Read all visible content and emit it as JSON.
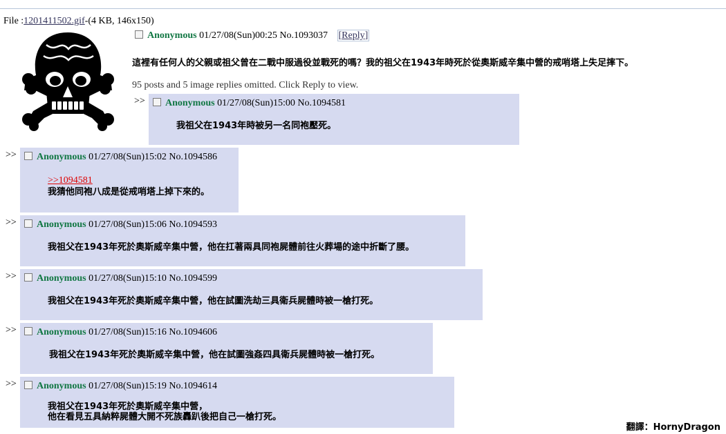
{
  "file": {
    "prefix": "File :",
    "filename": "1201411502.gif",
    "meta": "-(4 KB, 146x150)"
  },
  "op": {
    "name": "Anonymous",
    "datetime": "01/27/08(Sun)00:25",
    "number": "No.1093037",
    "reply_label": "Reply",
    "message": "這裡有任何人的父親或祖父曾在二戰中服過役並戰死的嗎？我的祖父在1943年時死於從奧斯威辛集中營的戒哨塔上失足摔下。",
    "omitted": "95 posts and 5 image replies omitted. Click Reply to view."
  },
  "arrow": ">>",
  "replies": [
    {
      "name": "Anonymous",
      "datetime": "01/27/08(Sun)15:00",
      "number": "No.1094581",
      "quote": "",
      "lines": [
        "我祖父在1943年時被另一名同袍壓死。"
      ]
    },
    {
      "name": "Anonymous",
      "datetime": "01/27/08(Sun)15:02",
      "number": "No.1094586",
      "quote": ">>1094581",
      "lines": [
        "我猜他同袍八成是從戒哨塔上掉下來的。"
      ]
    },
    {
      "name": "Anonymous",
      "datetime": "01/27/08(Sun)15:06",
      "number": "No.1094593",
      "quote": "",
      "lines": [
        "我祖父在1943年死於奧斯威辛集中營，他在扛著兩具同袍屍體前往火葬場的途中折斷了腰。"
      ]
    },
    {
      "name": "Anonymous",
      "datetime": "01/27/08(Sun)15:10",
      "number": "No.1094599",
      "quote": "",
      "lines": [
        "我祖父在1943年死於奧斯威辛集中營，他在試圖洗劫三具衛兵屍體時被一槍打死。"
      ]
    },
    {
      "name": "Anonymous",
      "datetime": "01/27/08(Sun)15:16",
      "number": "No.1094606",
      "quote": "",
      "lines": [
        "我祖父在1943年死於奧斯威辛集中營，他在試圖強姦四具衛兵屍體時被一槍打死。"
      ]
    },
    {
      "name": "Anonymous",
      "datetime": "01/27/08(Sun)15:19",
      "number": "No.1094614",
      "quote": "",
      "lines": [
        "我祖父在1943年死於奧斯威辛集中營，",
        "他在看見五具納粹屍體大開不死族轟趴後把自己一槍打死。"
      ]
    }
  ],
  "credit": "翻譯：HornyDragon",
  "colors": {
    "reply_bg": "#d6daf0",
    "name": "#117743",
    "quote": "#dd0000",
    "link": "#34345c"
  }
}
